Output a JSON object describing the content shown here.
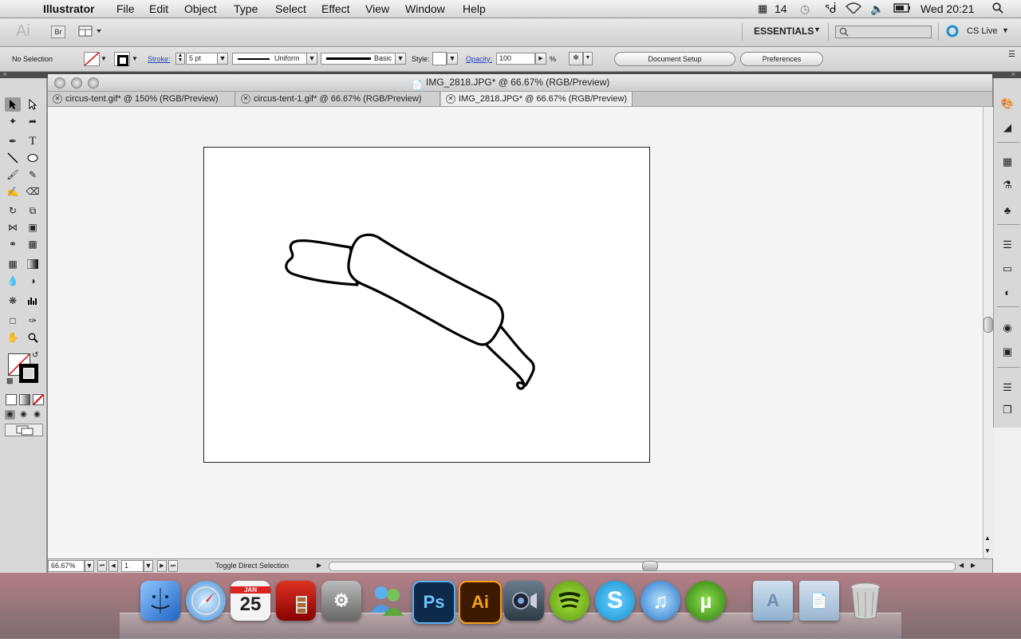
{
  "menubar": {
    "app_name": "Illustrator",
    "items": [
      "File",
      "Edit",
      "Object",
      "Type",
      "Select",
      "Effect",
      "View",
      "Window",
      "Help"
    ],
    "adobe_badge": "14",
    "clock": "Wed 20:21"
  },
  "appbar": {
    "ai_logo": "Ai",
    "bridge_label": "Br",
    "workspace": "ESSENTIALS",
    "search_placeholder": "",
    "cs_live": "CS Live"
  },
  "control": {
    "selection_status": "No Selection",
    "stroke_label": "Stroke:",
    "stroke_weight": "5 pt",
    "profile": "Uniform",
    "brush": "Basic",
    "style_label": "Style:",
    "opacity_label": "Opacity:",
    "opacity_value": "100",
    "percent": "%",
    "document_setup": "Document Setup",
    "preferences": "Preferences"
  },
  "document": {
    "title": "IMG_2818.JPG* @ 66.67% (RGB/Preview)",
    "tabs": [
      {
        "label": "circus-tent.gif* @ 150% (RGB/Preview)"
      },
      {
        "label": "circus-tent-1.gif* @ 66.67% (RGB/Preview)"
      },
      {
        "label": "IMG_2818.JPG* @ 66.67% (RGB/Preview)"
      }
    ],
    "active_tab": 2
  },
  "statusbar": {
    "zoom": "66.67%",
    "page": "1",
    "tool_hint": "Toggle Direct Selection"
  },
  "dock": {
    "apps": [
      {
        "name": "Finder",
        "icon": "finder-icon",
        "color": "#3a7bd5"
      },
      {
        "name": "Safari",
        "icon": "safari-icon",
        "color": "#4aa3df"
      },
      {
        "name": "Calendar",
        "icon": "calendar-icon",
        "color": "#e8e8e8",
        "month": "JAN",
        "day": "25"
      },
      {
        "name": "Photo Booth",
        "icon": "photobooth-icon",
        "color": "#b01818"
      },
      {
        "name": "System Preferences",
        "icon": "system-preferences-icon",
        "color": "#8a8a8a"
      },
      {
        "name": "Messenger",
        "icon": "messenger-icon",
        "color": "#4a9de0"
      },
      {
        "name": "Photoshop",
        "icon": "photoshop-icon",
        "color": "#0d2a4a",
        "text": "Ps"
      },
      {
        "name": "Illustrator",
        "icon": "illustrator-icon",
        "color": "#3b1a00",
        "text": "Ai"
      },
      {
        "name": "Screen Capture",
        "icon": "camera-icon",
        "color": "#4a5a6a"
      },
      {
        "name": "Spotify",
        "icon": "spotify-icon",
        "color": "#7ab800"
      },
      {
        "name": "Skype",
        "icon": "skype-icon",
        "color": "#1ba3e0"
      },
      {
        "name": "iTunes",
        "icon": "itunes-icon",
        "color": "#3a88d8"
      },
      {
        "name": "uTorrent",
        "icon": "utorrent-icon",
        "color": "#3c8e1c"
      },
      {
        "name": "Applications",
        "icon": "applications-folder-icon",
        "color": "#8fb0cf"
      },
      {
        "name": "Documents",
        "icon": "documents-folder-icon",
        "color": "#9ab5cf"
      },
      {
        "name": "Trash",
        "icon": "trash-icon",
        "color": "#b9b9b9"
      }
    ]
  }
}
